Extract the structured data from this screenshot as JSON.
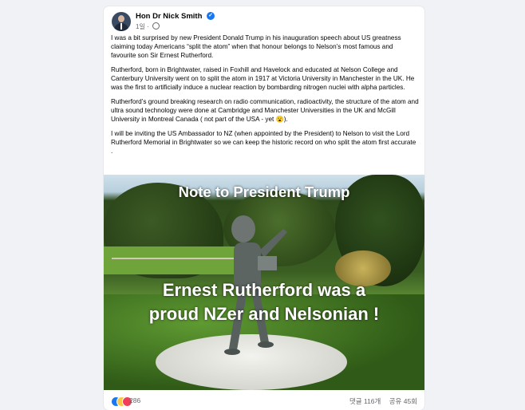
{
  "post": {
    "author": "Hon Dr Nick Smith",
    "timestamp": "1일",
    "paragraphs": [
      "I was a bit surprised by new President Donald Trump in his inauguration speech about US greatness claiming today Americans “split the atom” when that honour belongs to Nelson’s most famous and favourite son Sir Ernest Rutherford.",
      "Rutherford, born in Brightwater, raised in Foxhill and Havelock and educated at Nelson College and Canterbury University went on to split the atom in 1917 at Victoria University in Manchester in the UK. He was the first to artificially induce a nuclear reaction by bombarding nitrogen nuclei with alpha particles.",
      "Rutherford’s ground breaking research on radio communication, radioactivity, the structure of the atom and ultra sound technology were done at Cambridge and Manchester Universities in the UK and McGill University in Montreal Canada ( not part of the USA - yet 😮).",
      "I will be inviting the US Ambassador to NZ (when appointed by the President) to Nelson to visit the Lord Rutherford Memorial in Brightwater so we can keep the historic record on who split the atom first accurate ."
    ],
    "image": {
      "caption_top": "Note to President Trump",
      "caption_line1": "Ernest Rutherford was a",
      "caption_line2": "proud NZer and Nelsonian !"
    }
  },
  "footer": {
    "reaction_count": "286",
    "comments": "댓글 116개",
    "shares": "공유 45회"
  },
  "colors": {
    "accent": "#1877f2",
    "text": "#050505",
    "muted": "#65676b",
    "background": "#f0f2f5"
  },
  "icons": [
    "verified-badge-icon",
    "globe-icon",
    "like-reaction-icon",
    "haha-reaction-icon",
    "love-reaction-icon"
  ]
}
